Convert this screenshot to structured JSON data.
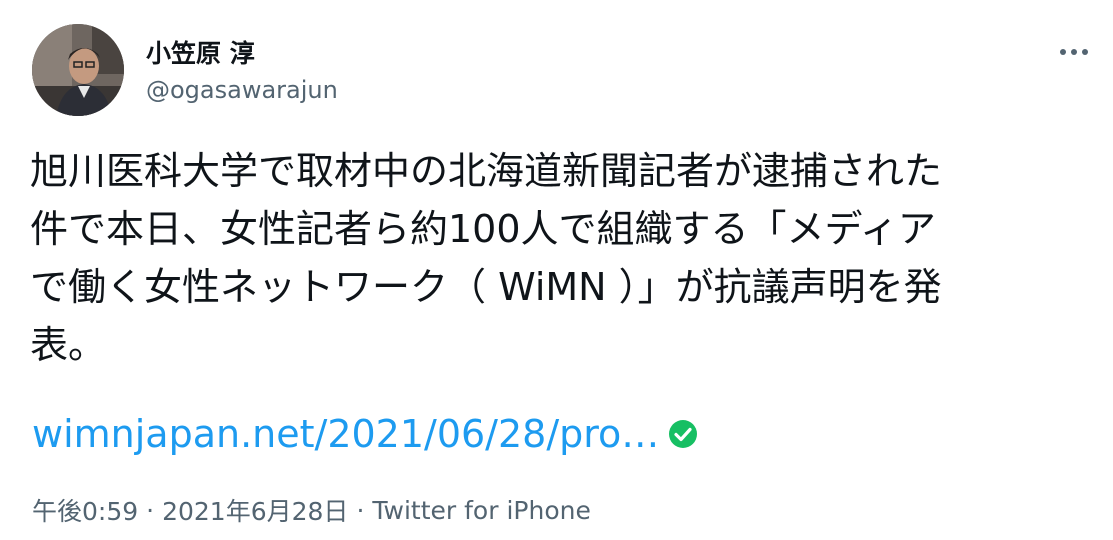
{
  "author": {
    "display_name": "小笠原 淳",
    "handle": "@ogasawarajun",
    "avatar": "profile-photo-avatar"
  },
  "menu": {
    "icon": "more-horizontal-icon"
  },
  "tweet": {
    "text_lines": [
      "旭川医科大学で取材中の北海道新聞記者が逮捕された",
      "件で本日、女性記者ら約100人で組織する「メディア",
      "で働く女性ネットワーク（ WiMN ）」が抗議声明を発",
      "表。"
    ],
    "link_text": "wimnjapan.net/2021/06/28/pro…",
    "link_icon": "green-check-icon"
  },
  "meta": {
    "time": "午後0:59",
    "date": "2021年6月28日",
    "source": "Twitter for iPhone",
    "separator": "·"
  },
  "colors": {
    "text": "#0f1419",
    "secondary": "#536471",
    "link": "#1d9bf0",
    "check": "#17bf63"
  }
}
